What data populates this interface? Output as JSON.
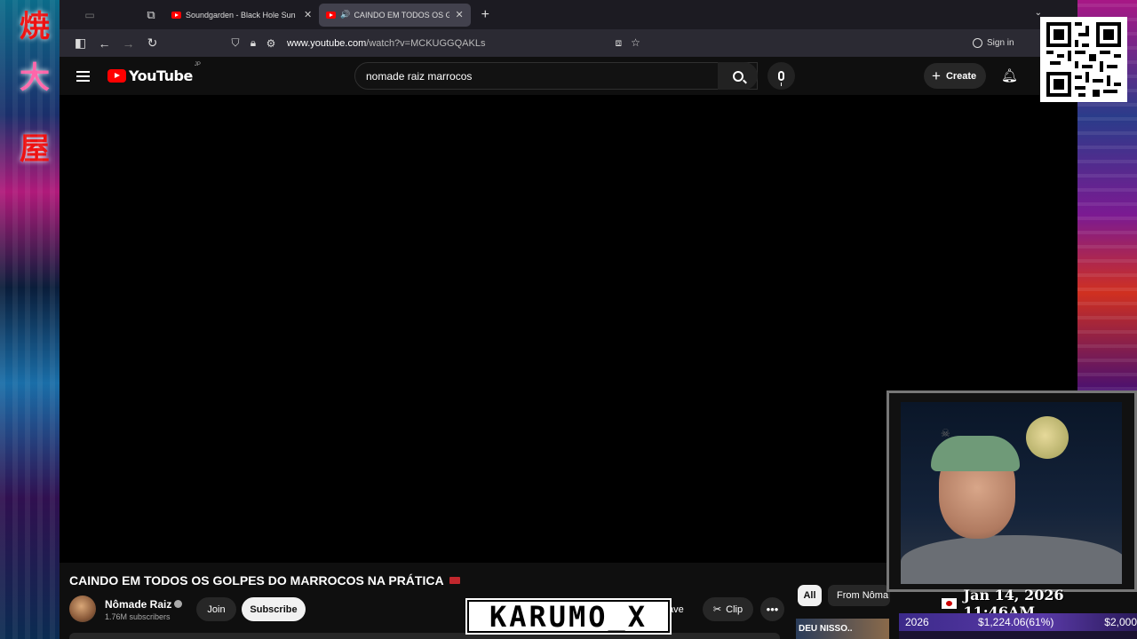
{
  "browser": {
    "tabs": [
      {
        "title": "Soundgarden - Black Hole Sun",
        "active": false
      },
      {
        "title": "CAINDO EM TODOS OS GOLPES",
        "active": true
      }
    ],
    "url_domain": "www.youtube.com",
    "url_path": "/watch?v=MCKUGGQAKLs",
    "sign_in": "Sign in"
  },
  "youtube": {
    "logo": "YouTube",
    "region": "JP",
    "search_value": "nomade raiz marrocos",
    "create_label": "Create",
    "video_title": "CAINDO EM TODOS OS GOLPES DO MARROCOS NA PRÁTICA",
    "channel_name": "Nômade Raiz",
    "subscribers": "1.76M subscribers",
    "join_label": "Join",
    "subscribe_label": "Subscribe",
    "save_label": "ave",
    "clip_label": "Clip",
    "chips": [
      "All",
      "From Nôma"
    ],
    "related_thumb_text": "DEU NISSO.."
  },
  "stream_overlay": {
    "watermark": "KARUMO_X",
    "date_time": "Jan 14, 2026 11:46AM",
    "goal_year": "2026",
    "goal_amount": "$1,224.06(61%)",
    "goal_target": "$2,000",
    "goal_progress_pct": 61
  }
}
